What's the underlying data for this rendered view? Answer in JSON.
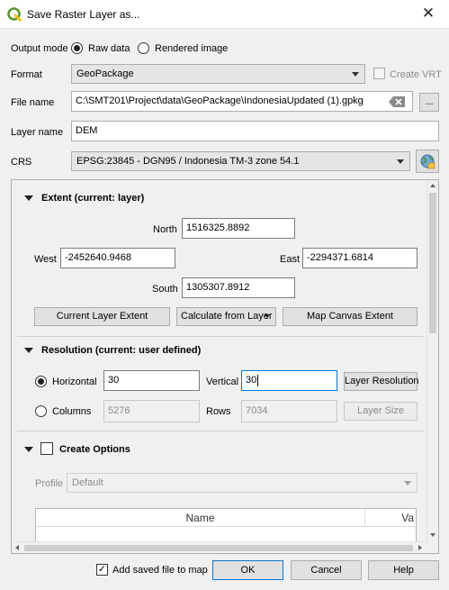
{
  "window": {
    "title": "Save Raster Layer as...",
    "close_glyph": "✕",
    "icon": "qgis-logo-icon"
  },
  "output_mode": {
    "label": "Output mode",
    "raw_label": "Raw data",
    "rendered_label": "Rendered image",
    "selected": "raw"
  },
  "format": {
    "label": "Format",
    "value": "GeoPackage",
    "create_vrt_label": "Create VRT"
  },
  "file_name": {
    "label": "File name",
    "value": "C:\\SMT201\\Project\\data\\GeoPackage\\IndonesiaUpdated (1).gpkg",
    "browse_label": "..."
  },
  "layer_name": {
    "label": "Layer name",
    "value": "DEM"
  },
  "crs": {
    "label": "CRS",
    "value": "EPSG:23845 - DGN95 / Indonesia TM-3 zone 54.1"
  },
  "extent": {
    "title": "Extent (current: layer)",
    "north_label": "North",
    "north": "1516325.8892",
    "west_label": "West",
    "west": "-2452640.9468",
    "east_label": "East",
    "east": "-2294371.6814",
    "south_label": "South",
    "south": "1305307.8912",
    "current_layer_btn": "Current Layer Extent",
    "calculate_btn": "Calculate from Layer",
    "map_canvas_btn": "Map Canvas Extent"
  },
  "resolution": {
    "title": "Resolution (current: user defined)",
    "horizontal_label": "Horizontal",
    "horizontal": "30",
    "vertical_label": "Vertical",
    "vertical": "30",
    "layer_resolution_btn": "Layer Resolution",
    "columns_label": "Columns",
    "columns": "5276",
    "rows_label": "Rows",
    "rows": "7034",
    "layer_size_btn": "Layer Size",
    "selected": "horizontal"
  },
  "create_options": {
    "title": "Create Options",
    "profile_label": "Profile",
    "profile_value": "Default",
    "columns": [
      "Name",
      "Va"
    ]
  },
  "footer": {
    "add_to_map_label": "Add saved file to map",
    "add_to_map_checked": true,
    "ok": "OK",
    "cancel": "Cancel",
    "help": "Help"
  },
  "colors": {
    "focus": "#0078d7",
    "window_bg": "#f0f0f0",
    "qgis_green": "#589632"
  }
}
